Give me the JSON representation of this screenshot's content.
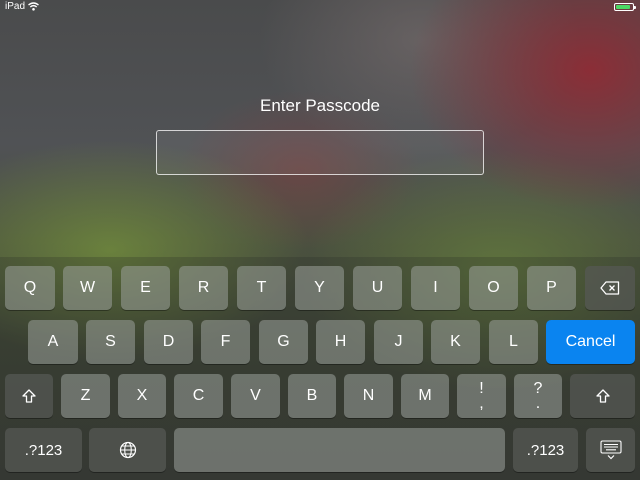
{
  "status_bar": {
    "device": "iPad",
    "battery_color": "#4cd964",
    "battery_level": 0.9
  },
  "title": "Enter Passcode",
  "passcode": {
    "value": ""
  },
  "keyboard": {
    "row1": [
      "Q",
      "W",
      "E",
      "R",
      "T",
      "Y",
      "U",
      "I",
      "O",
      "P"
    ],
    "row2": [
      "A",
      "S",
      "D",
      "F",
      "G",
      "H",
      "J",
      "K",
      "L"
    ],
    "row3": [
      "Z",
      "X",
      "C",
      "V",
      "B",
      "N",
      "M"
    ],
    "punct1": {
      "top": "!",
      "bottom": ","
    },
    "punct2": {
      "top": "?",
      "bottom": "."
    },
    "cancel_label": "Cancel",
    "numbers_label": ".?123",
    "accent_color": "#0a84f0",
    "icons": [
      "backspace-icon",
      "shift-icon",
      "globe-icon",
      "hide-keyboard-icon",
      "wifi-icon",
      "battery-icon"
    ]
  }
}
